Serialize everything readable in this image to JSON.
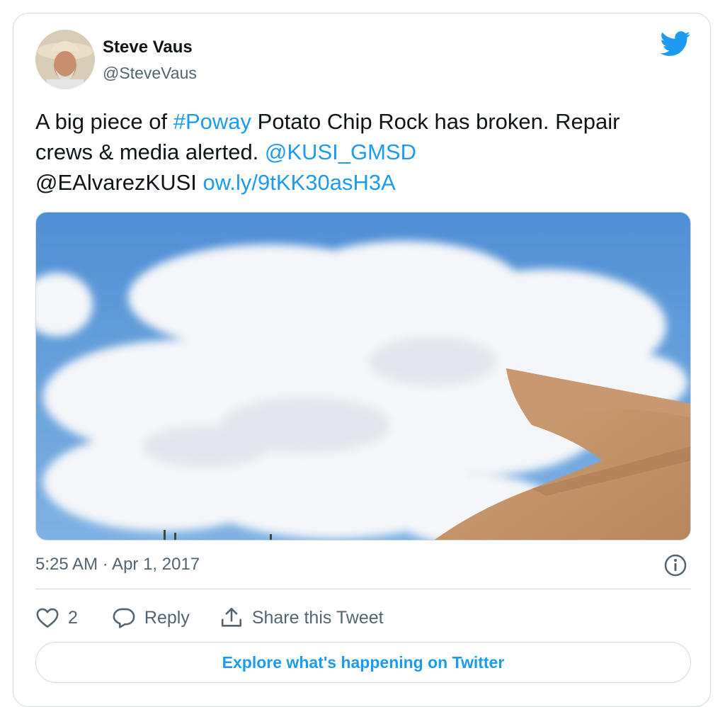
{
  "author": {
    "name": "Steve Vaus",
    "handle": "@SteveVaus"
  },
  "tweet": {
    "text_part1": "A big piece of ",
    "hashtag": "#Poway",
    "text_part2": " Potato Chip  Rock has broken. Repair crews & media alerted. ",
    "mention1": "@KUSI_GMSD",
    "mention2_plain": "@EAlvarezKUSI",
    "link": "ow.ly/9tKK30asH3A",
    "timestamp": "5:25 AM · Apr 1, 2017"
  },
  "actions": {
    "like_count": "2",
    "reply_label": "Reply",
    "share_label": "Share this Tweet"
  },
  "explore_button": "Explore what's happening on Twitter",
  "colors": {
    "accent": "#1d9bf0",
    "text": "#0f1419",
    "secondary": "#536471",
    "border": "#cfd9de"
  },
  "icons": [
    "twitter-bird-icon",
    "info-icon",
    "heart-icon",
    "reply-icon",
    "share-icon"
  ]
}
